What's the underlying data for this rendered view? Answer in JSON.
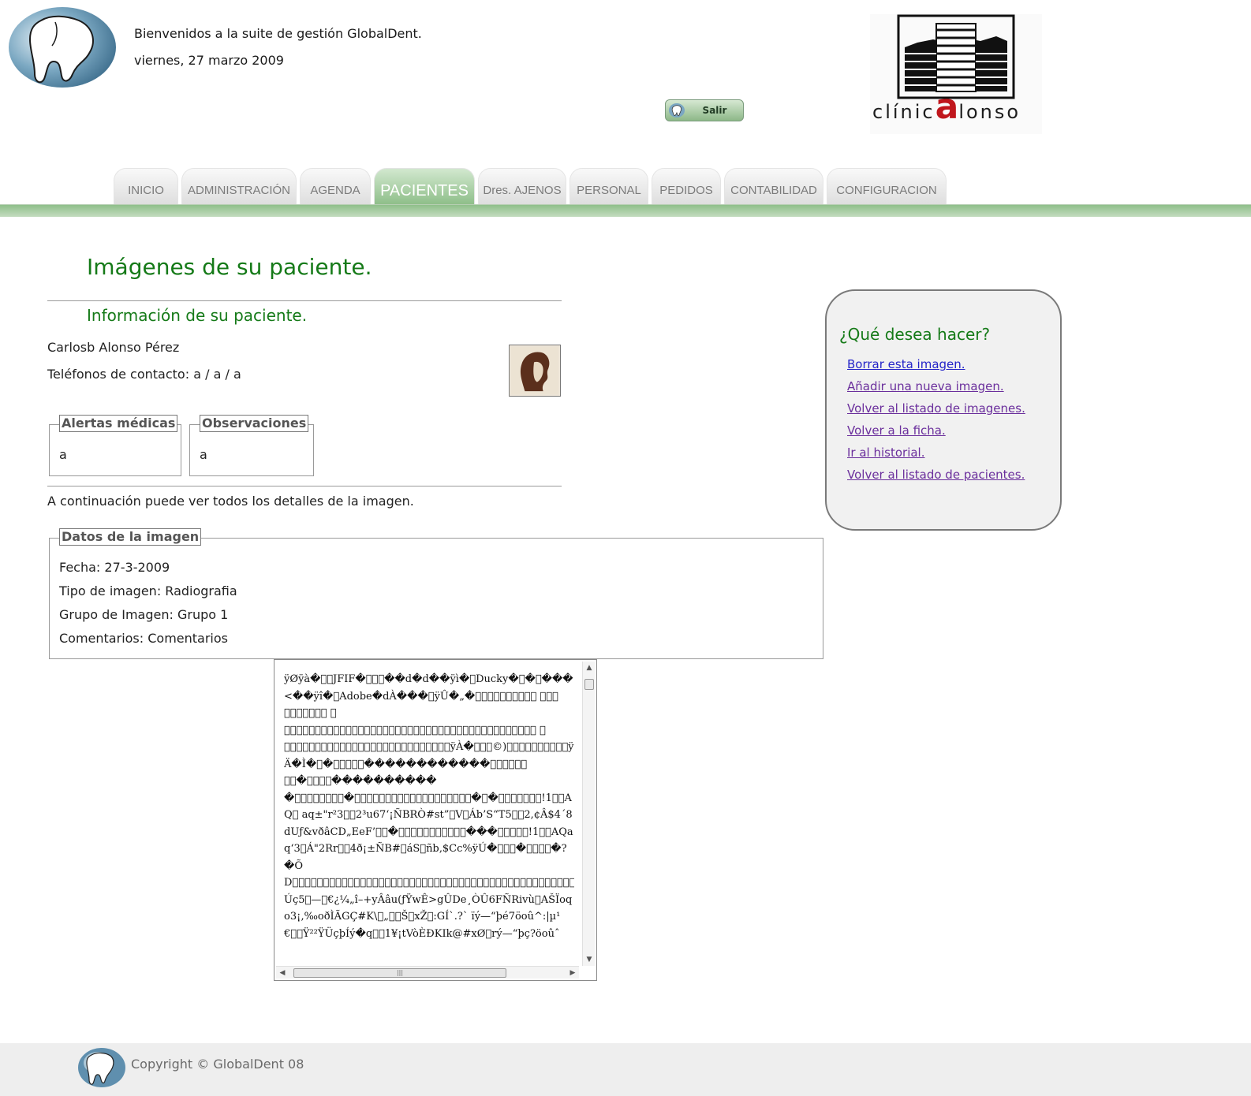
{
  "header": {
    "welcome": "Bienvenidos a la suite de gestión GlobalDent.",
    "date": "viernes, 27 marzo 2009",
    "logout_label": "Salir",
    "clinic_logo_text": "clínicalonso",
    "clinic_name_pre": "clínic",
    "clinic_name_a": "a",
    "clinic_name_post": "lonso"
  },
  "nav": {
    "tabs": [
      {
        "label": "INICIO",
        "active": false
      },
      {
        "label": "ADMINISTRACIÓN",
        "active": false
      },
      {
        "label": "AGENDA",
        "active": false
      },
      {
        "label": "PACIENTES",
        "active": true
      },
      {
        "label": "Dres. AJENOS",
        "active": false
      },
      {
        "label": "PERSONAL",
        "active": false
      },
      {
        "label": "PEDIDOS",
        "active": false
      },
      {
        "label": "CONTABILIDAD",
        "active": false
      },
      {
        "label": "CONFIGURACION",
        "active": false
      }
    ]
  },
  "main": {
    "page_title": "Imágenes de su paciente.",
    "patient_section_title": "Información de su paciente.",
    "patient_name": "Carlosb Alonso Pérez",
    "phones_label": "Teléfonos de contacto:",
    "phones_value": "a / a / a",
    "alerts": {
      "legend": "Alertas médicas",
      "value": "a"
    },
    "observations": {
      "legend": "Observaciones",
      "value": "a"
    },
    "continue_text": "A continuación puede ver todos los detalles de la imagen.",
    "image_data": {
      "legend": "Datos de la imagen",
      "fecha": "Fecha: 27-3-2009",
      "tipo": "Tipo de imagen: Radiografia",
      "grupo": "Grupo de Imagen: Grupo 1",
      "comentarios": "Comentarios: Comentarios"
    },
    "raw_image_text": "ÿØÿà�\u0000\u0010JFIF�\u0000\u0001\u0002��d�d��ÿì�\u0011Ducky�\u0001�\u0004���<��ÿî�\u000eAdobe�dÀ���\u0001ÿÛ�„�\u0006\u0004\u0004\u0004\u0005\u0004\u0006\u0005\u0005\u0006\t\u0006\u0005\u0006\t\u000b\b\u0006\u0006\b\u000b\f\n\n\u000b\n\n\f\u0010\f\f\f\f\f\f\u0010\f\u000e\u000f\u0010\u000f\u000e\f\u0013\u0013\u0014\u0014\u0013\u0013\u001c\u001b\u001b\u001b\u001c\u001f\u001f\u001f\u001f\u001f\u001f\u001f\u001f\u001f\u001f\u0001\u0007\u0007\u0007\r\f\r\u0018\u0010\u0010\u0018\u001a\u0015\u0011\u0015\u001a\u001f\u001f\u001f\u001f\u001f\u001f\u001f\u001f\u001f\u001f\u001f\u001f\u001f\u001f\u001f\u001f\u001f\u001fÿÀ�\u0011\b\u0001©)\u0003\u0001\u0011\u0000\u0002\u0011\u0001\u0003\u0011\u0001ÿÄ�Ì�\u0001�\u0000\u0003\u0001\u0001\u0001������������\u0007\u0005\u0006\b\u0003\u0004\t\u0001\u0001�\u0002\u0003\u0001\u0001�����������\u0003\u0005\u0002\u0004\u0006\u0007\u0001\b�\u0001\u0003\u0002\u0004\u0005\u0006\u0004\u0004\u0006\u0004\u0003\u0004\u0004\u0001\u0002\u0003\u0003\u0001\u0001�\u0000�\u0002\u0003\u0001\u0004\u0005\u0006\u0000!1\u0012\u0007AQ\u0013\taq±\"r²3\u0014\u00052³u67‘¡ÑBRÒ#st”\u0015V\u0017Áb’S“T5\u0016\u00112,¢Â$4´8dUƒ&vðâCD„EeF’\u0011\u0001�\u0002\u0002\u0001\u0004\u0004\u0005\u0006\u0003\u0005\u0004\u0003���\u0001\u0002\u0003\u0011\u0004!1\u0012\u0005AQaq‘3\u0014Á\"2Rr\u0013\u00154ð¡±ÑB#\u0006áS\u0016ñb‚$Cc%ÿÚ�\u0000\u0003\u0001�\u0002\u0011\u0003\u0011�?�ÕD\u0004\u0004\u0004\u0004\u0004\u0004\u0004\u0004\u0004\u0004\u0004\u0004\u0004\u0004\u0004\u0004\u0004\u0004\u0004\u0004\u0004\u0004\u0004\u0004\u0004\u0004\u0004\u0004\u0004\u0004\u0004\u0004\u0004\u0004\u0004\u0004\u0004\u0004\u0004\u0004\u0004\u0004\u0004\u0004\u0004\u0004\u0004\u0004\u0004\u0004\u0004\u0004\u0004\u0004\u0004\u0004\u0004\u0004\u0004\u0004\u0004\u0004\u0004\u0004\u0004\u0004\u0004\u0004\u0004\u0004\u0004\u0004\u0004\u0004\u0004\u0004\u0004\u0004\u0004\u0004\u0004\u0004\u0004\u0004\u0004\u0004\u0004\u0004\u0004\u0004\u0004—Úç5\u0001—\u0015€¿¼„î–+yÂâu(ƒŸwÊ>gÛDe¸ÒÛ6FÑRivù\u0005AŠÏoqo3¡‚‰oðÌÃGÇ#K\\\u000f„\u0017\u0007Š\u0018xŽ\u000e:GÍ`.?` ïý—“þé7öoû^:|µ¹€\u0014\u0004Ÿ²²ŸÜçþÍý�q\u0005\u00121¥¡tVòÈÐKIk@#xØ\u0007rý—“þç?öoûˆ"
  },
  "sidebar": {
    "title": "¿Qué desea hacer?",
    "links": [
      "Borrar esta imagen.",
      "Añadir una nueva imagen.",
      "Volver al listado de imagenes.",
      "Volver a la ficha.",
      "Ir al historial.",
      "Volver al listado de pacientes."
    ]
  },
  "footer": {
    "copyright": "Copyright © GlobalDent 08"
  },
  "colors": {
    "accent_green": "#157a18",
    "nav_bar_green": "#8fbf8a",
    "clinic_red": "#c0161c",
    "link_visited": "#6a2e9c",
    "link_blue": "#2424c8"
  }
}
